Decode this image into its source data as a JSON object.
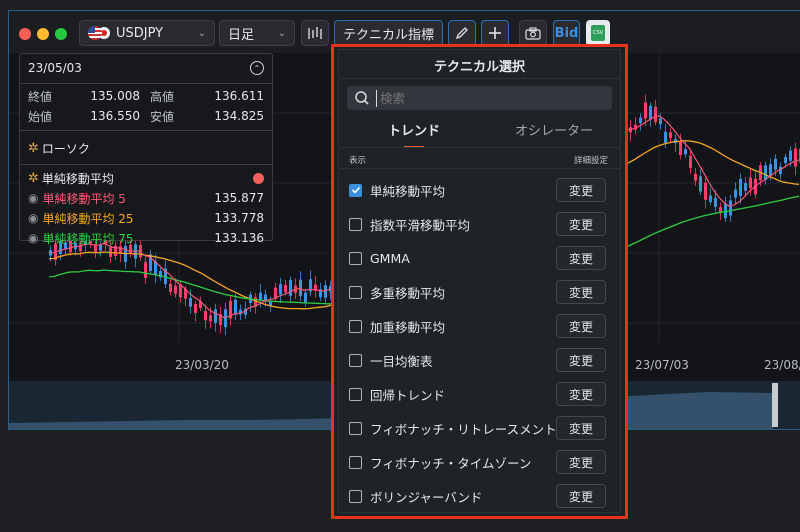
{
  "toolbar": {
    "symbol": "USDJPY",
    "timeframe": "日足",
    "indicators_button": "テクニカル指標",
    "bid_button": "Bid"
  },
  "info_panel": {
    "date": "23/05/03",
    "close_label": "終値",
    "close_value": "135.008",
    "high_label": "高値",
    "high_value": "136.611",
    "open_label": "始値",
    "open_value": "136.550",
    "low_label": "安値",
    "low_value": "134.825",
    "candle_label": "ローソク",
    "sma_group_label": "単純移動平均",
    "sma": [
      {
        "label": "単純移動平均 5",
        "value": "135.877",
        "color": "#ff5c7a"
      },
      {
        "label": "単純移動平均 25",
        "value": "133.778",
        "color": "#f5a623"
      },
      {
        "label": "単純移動平均 75",
        "value": "133.136",
        "color": "#2ecc40"
      }
    ]
  },
  "axis": {
    "dates": [
      "23/03/20",
      "23/07/03",
      "23/08/"
    ]
  },
  "dialog": {
    "title": "テクニカル選択",
    "search_placeholder": "検索",
    "tabs": [
      {
        "label": "トレンド",
        "active": true
      },
      {
        "label": "オシレーター",
        "active": false
      }
    ],
    "col_show": "表示",
    "col_settings": "詳細設定",
    "change_label": "変更",
    "items": [
      {
        "label": "単純移動平均",
        "checked": true
      },
      {
        "label": "指数平滑移動平均",
        "checked": false
      },
      {
        "label": "GMMA",
        "checked": false
      },
      {
        "label": "多重移動平均",
        "checked": false
      },
      {
        "label": "加重移動平均",
        "checked": false
      },
      {
        "label": "一目均衡表",
        "checked": false
      },
      {
        "label": "回帰トレンド",
        "checked": false
      },
      {
        "label": "フィボナッチ・リトレースメント",
        "checked": false
      },
      {
        "label": "フィボナッチ・タイムゾーン",
        "checked": false
      },
      {
        "label": "ボリンジャーバンド",
        "checked": false
      }
    ]
  },
  "colors": {
    "up": "#3b93e6",
    "down": "#ff3d6e",
    "highlight": "#e8321e",
    "accent": "#3a8fe0"
  }
}
